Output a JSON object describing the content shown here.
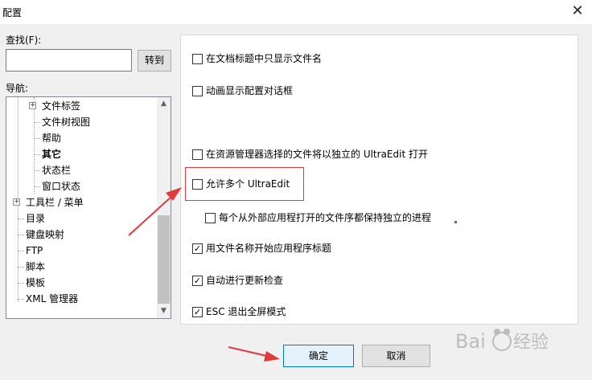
{
  "window": {
    "title": "配置",
    "close_glyph": "✕"
  },
  "search": {
    "label": "查找(F):",
    "value": "",
    "placeholder": "",
    "goto_label": "转到"
  },
  "nav": {
    "label": "导航:",
    "items": [
      {
        "label": "文件标签",
        "expander": "+"
      },
      {
        "label": "文件树视图"
      },
      {
        "label": "帮助"
      },
      {
        "label": "其它"
      },
      {
        "label": "状态栏"
      },
      {
        "label": "窗口状态"
      },
      {
        "label": "工具栏 / 菜单",
        "expander": "+"
      },
      {
        "label": "目录"
      },
      {
        "label": "键盘映射"
      },
      {
        "label": "FTP"
      },
      {
        "label": "脚本"
      },
      {
        "label": "模板"
      },
      {
        "label": "XML 管理器"
      }
    ]
  },
  "options": [
    {
      "label": "在文档标题中只显示文件名",
      "checked": false
    },
    {
      "label": "动画显示配置对话框",
      "checked": false
    },
    {
      "label": "在资源管理器选择的文件将以独立的 UltraEdit 打开",
      "checked": false
    },
    {
      "label": "允许多个 UltraEdit",
      "checked": false
    },
    {
      "label": "每个从外部应用程打开的文件序都保持独立的进程",
      "checked": false
    },
    {
      "label": "用文件名称开始应用程序标题",
      "checked": true
    },
    {
      "label": "自动进行更新检查",
      "checked": true
    },
    {
      "label": "ESC 退出全屏模式",
      "checked": true
    }
  ],
  "buttons": {
    "ok": "确定",
    "cancel": "取消"
  },
  "colors": {
    "annotation": "#e03a3a",
    "accent": "#0078d7"
  },
  "icons": {
    "close": "close-icon",
    "scroll_up": "scroll-up-icon",
    "scroll_down": "scroll-down-icon",
    "expander": "expander-plus-icon",
    "check": "check-icon"
  }
}
